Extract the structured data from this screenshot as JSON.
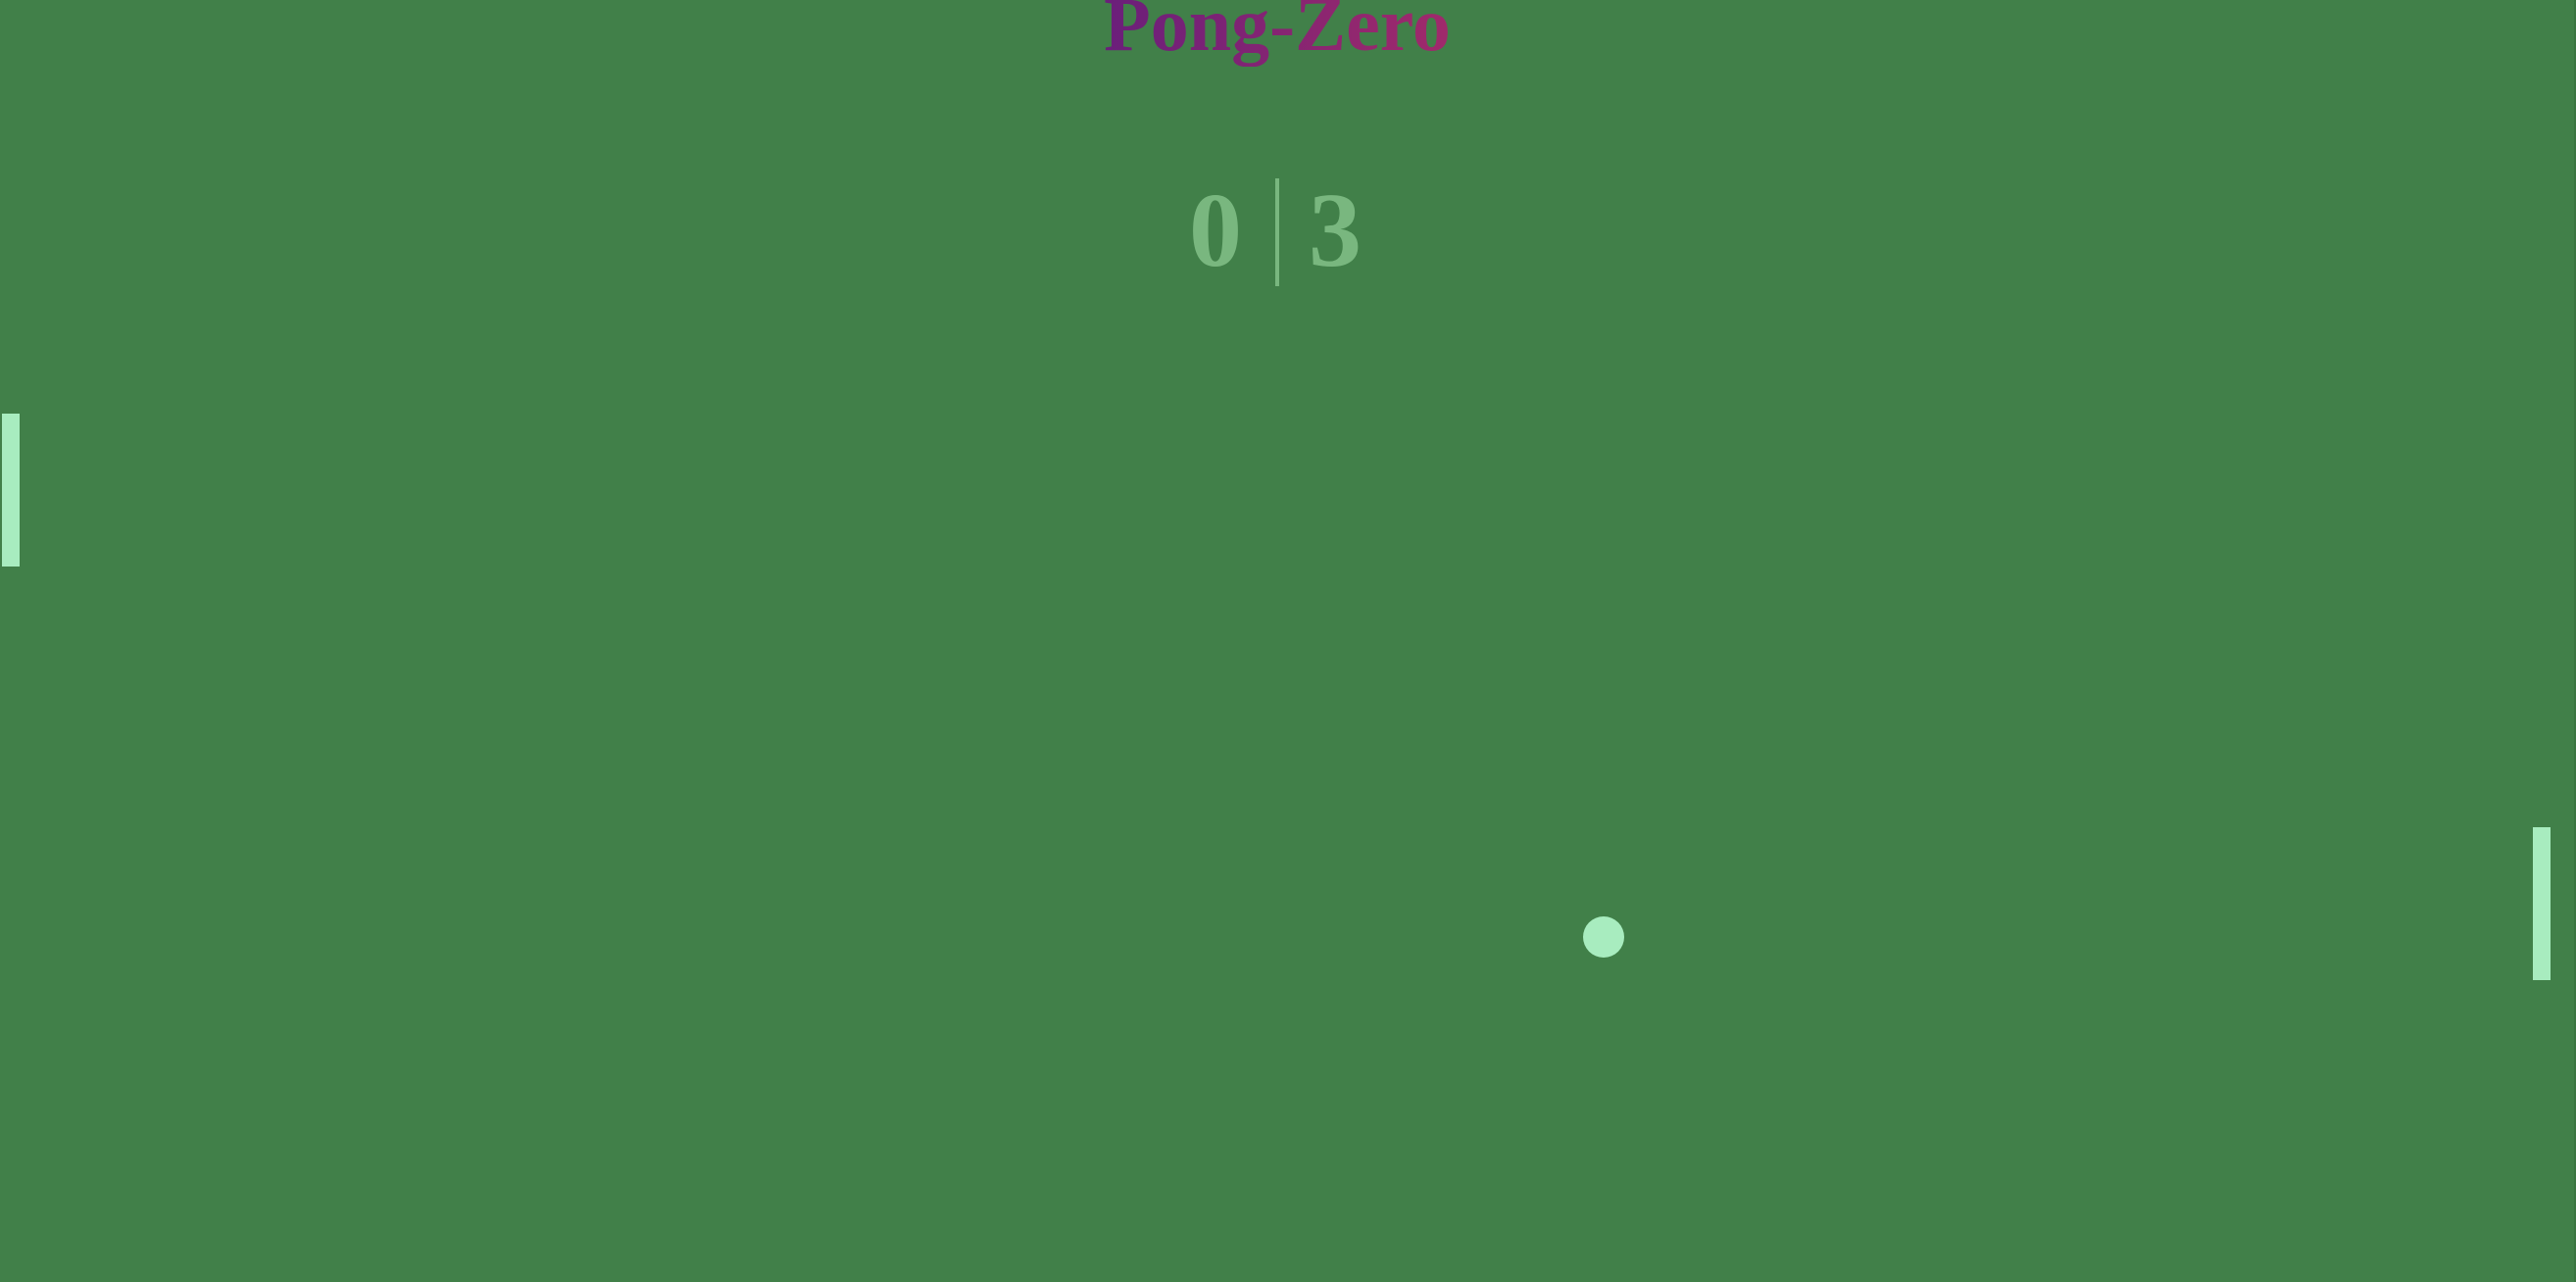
{
  "title": "Pong-Zero",
  "score": {
    "left": "0",
    "right": "3"
  },
  "colors": {
    "background": "#418049",
    "paddle": "#a8ecbf",
    "ball": "#a8ecbf",
    "score": "#79b77f",
    "title_gradient_start": "#6a1f7a",
    "title_gradient_end": "#a02a6b"
  }
}
